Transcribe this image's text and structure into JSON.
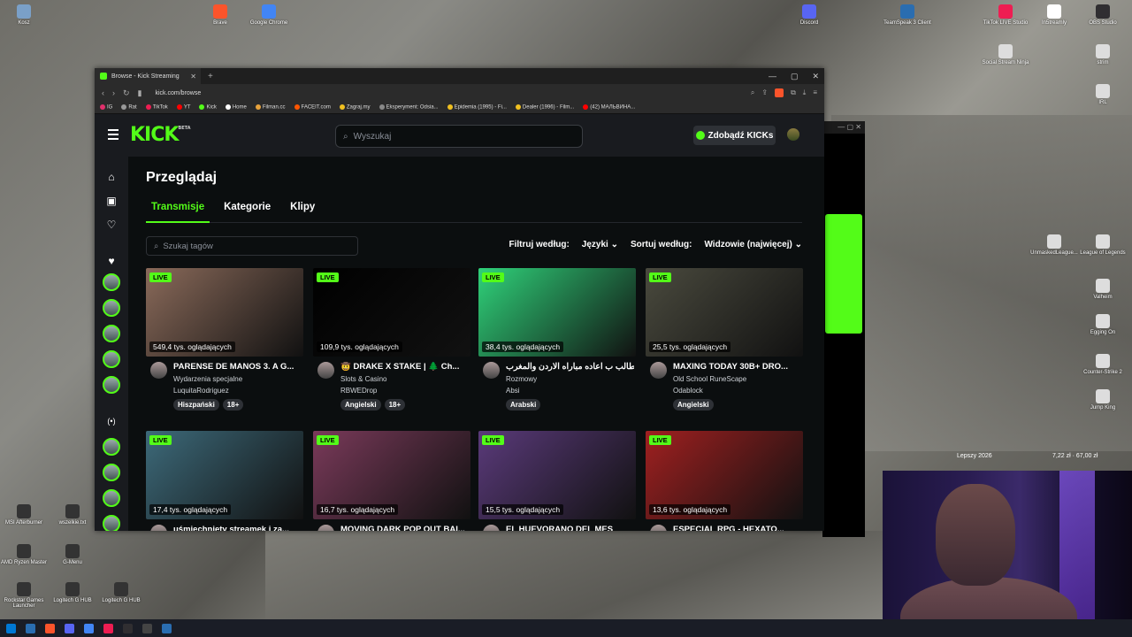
{
  "desktop": {
    "icons_top": [
      {
        "label": "Kosz",
        "color": "#7aa0c8"
      },
      {
        "label": "Brave",
        "color": "#fb542b"
      },
      {
        "label": "Google Chrome",
        "color": "#4285f4"
      },
      {
        "label": "Discord",
        "color": "#5865f2"
      },
      {
        "label": "TeamSpeak 3 Client",
        "color": "#2a6db0"
      },
      {
        "label": "TikTok LIVE Studio",
        "color": "#ee1d52"
      },
      {
        "label": "In5treamly",
        "color": "#ffffff"
      },
      {
        "label": "OBS Studio",
        "color": "#302e31"
      }
    ],
    "icons_right": [
      {
        "label": "Social Stream Ninja"
      },
      {
        "label": "strim"
      },
      {
        "label": "IRL"
      },
      {
        "label": "UnmaskedLeague..."
      },
      {
        "label": "League of Legends"
      },
      {
        "label": "Valheim"
      },
      {
        "label": "Egging On"
      },
      {
        "label": "Counter-Strike 2"
      },
      {
        "label": "Jump King"
      }
    ],
    "icons_left": [
      {
        "label": "MSI Afterburner"
      },
      {
        "label": "wszelkie.txt"
      },
      {
        "label": "AMD Ryzen Master"
      },
      {
        "label": "G-Menu"
      },
      {
        "label": "Rockstar Games Launcher"
      },
      {
        "label": "Logitech G HUB"
      },
      {
        "label": "Logitech G HUB"
      }
    ],
    "ticker_left": "Lepszy 2026",
    "ticker_right": "7,22 zł · 67,00 zł"
  },
  "browser": {
    "tab_title": "Browse - Kick Streaming",
    "new_tab": "+",
    "url": "kick.com/browse",
    "bookmarks": [
      {
        "label": "IG",
        "color": "#e1306c"
      },
      {
        "label": "Rat",
        "color": "#999999"
      },
      {
        "label": "TikTok",
        "color": "#ee1d52"
      },
      {
        "label": "YT",
        "color": "#ff0000"
      },
      {
        "label": "Kick",
        "color": "#53fc18"
      },
      {
        "label": "Home",
        "color": "#ffffff"
      },
      {
        "label": "Filman.cc",
        "color": "#e8a33c"
      },
      {
        "label": "FACEIT.com",
        "color": "#ff5500"
      },
      {
        "label": "Zagraj.my",
        "color": "#f0c020"
      },
      {
        "label": "Eksperyment: Odsia...",
        "color": "#888888"
      },
      {
        "label": "Epidemia (1995) - Fi...",
        "color": "#f0c020"
      },
      {
        "label": "Dealer (1996) - Film...",
        "color": "#f0c020"
      },
      {
        "label": "(42) МАЛЬВИНА...",
        "color": "#ff0000"
      }
    ]
  },
  "kick": {
    "logo": "KICK",
    "logo_badge": "BETA",
    "search_placeholder": "Wyszukaj",
    "get_kicks": "Zdobądź KICKs",
    "page_title": "Przeglądaj",
    "tabs": [
      "Transmisje",
      "Kategorie",
      "Klipy"
    ],
    "tag_search_placeholder": "Szukaj tagów",
    "filter_label": "Filtruj według:",
    "filter_value": "Języki",
    "sort_label": "Sortuj według:",
    "sort_value": "Widzowie (najwięcej)",
    "live_label": "LIVE",
    "streams": [
      {
        "title": "PARENSE DE MANOS 3. A G...",
        "category": "Wydarzenia specjalne",
        "user": "LuquitaRodriguez",
        "viewers": "549,4 tys. oglądających",
        "tags": [
          "Hiszpański",
          "18+"
        ],
        "thumb": "#8a6a5a"
      },
      {
        "title": "🤠 DRAKE X STAKE | 🌲 Ch...",
        "category": "Slots & Casino",
        "user": "RBWEDrop",
        "viewers": "109,9 tys. oglądających",
        "tags": [
          "Angielski",
          "18+"
        ],
        "thumb": "#000000"
      },
      {
        "title": "نطالب ب اعاده مباراه الاردن والمغرب",
        "category": "Rozmowy",
        "user": "Absi",
        "viewers": "38,4 tys. oglądających",
        "tags": [
          "Arabski"
        ],
        "thumb": "#2fd27a"
      },
      {
        "title": "MAXING TODAY 30B+ DRO...",
        "category": "Old School RuneScape",
        "user": "Odablock",
        "viewers": "25,5 tys. oglądających",
        "tags": [
          "Angielski"
        ],
        "thumb": "#4a4a3e"
      },
      {
        "title": "uśmiechnięty streamek i za...",
        "category": "",
        "user": "",
        "viewers": "17,4 tys. oglądających",
        "tags": [],
        "thumb": "#3d6a7a"
      },
      {
        "title": "MOVING DARK POP OUT BAI...",
        "category": "",
        "user": "",
        "viewers": "16,7 tys. oglądających",
        "tags": [],
        "thumb": "#7a3a5a"
      },
      {
        "title": "EL HUEVORANO DEL MES",
        "category": "",
        "user": "",
        "viewers": "15,5 tys. oglądających",
        "tags": [],
        "thumb": "#5a3a7a"
      },
      {
        "title": "ESPECIAL RPG - HEXATO...",
        "category": "",
        "user": "",
        "viewers": "13,6 tys. oglądających",
        "tags": [],
        "thumb": "#a02020"
      }
    ]
  }
}
